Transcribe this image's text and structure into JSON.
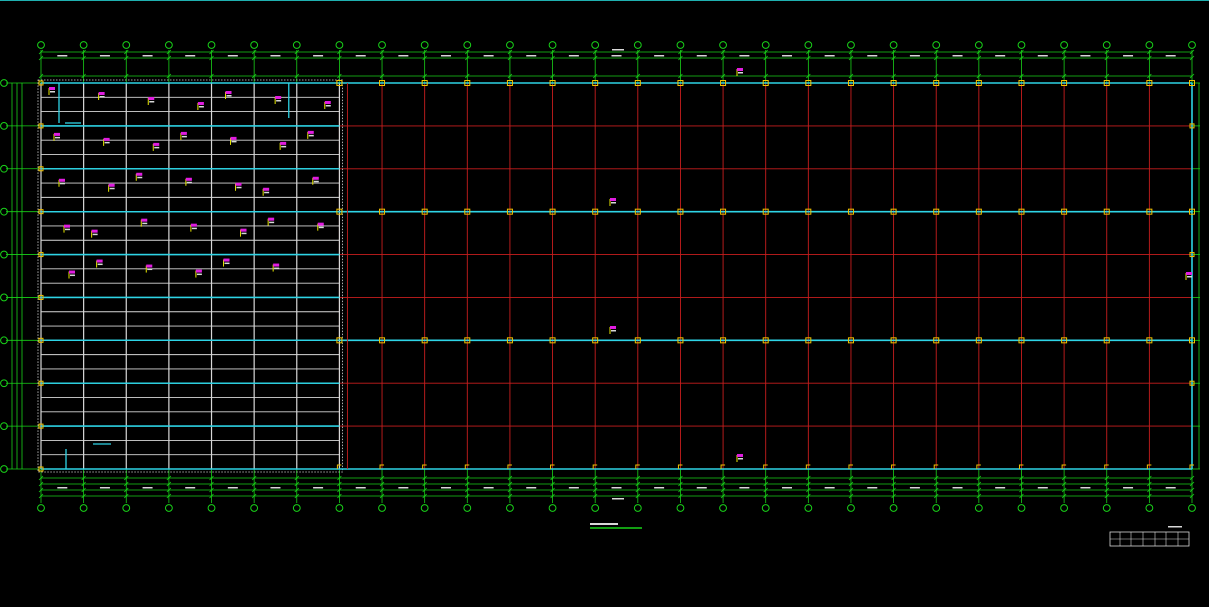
{
  "drawing": {
    "kind": "structural-grid-plan",
    "colors": {
      "background": "#000000",
      "grid_green": "#19d219",
      "grid_red": "#c81e1e",
      "beam_cyan": "#2ed4e6",
      "column_yellow": "#f2c200",
      "annotation_magenta": "#e01ce0",
      "annotation_yellow": "#e8e800",
      "text_white": "#d8d8d8",
      "frame_teal": "#1fb0b0"
    },
    "vertical_grid_line_count": 28,
    "horizontal_grid_line_count": 10,
    "dense_zone_column_count": 7,
    "dense_zone_sub_rows_per_bay": 3,
    "annotation_flags": 34
  }
}
